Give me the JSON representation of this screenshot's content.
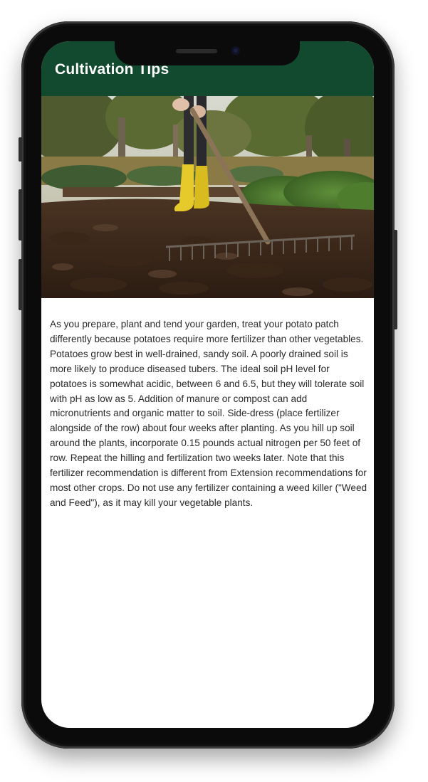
{
  "app": {
    "title": "Cultivation Tips"
  },
  "hero_image": {
    "subject": "person in yellow rubber boots raking dark tilled garden soil"
  },
  "content": {
    "paragraph": "As you prepare, plant and tend your garden, treat your potato patch differently because potatoes require more fertilizer than other vegetables. Potatoes grow best in well-drained, sandy soil. A poorly drained soil is more likely to produce diseased tubers. The ideal soil pH level for potatoes is somewhat acidic, between 6 and 6.5, but they will tolerate soil with pH as low as 5. Addition of manure or compost can add micronutrients and organic matter to soil. Side-dress (place fertilizer alongside of the row) about four weeks after planting. As you hill up soil around the plants, incorporate 0.15 pounds actual nitrogen per 50 feet of row. Repeat the hilling and fertilization two weeks later. Note that this fertilizer recommendation is different from Extension recommendations for most other crops. Do not use any fertilizer containing a weed killer (\"Weed and Feed\"), as it may kill your vegetable plants."
  },
  "colors": {
    "appbar": "#114a2e",
    "title_text": "#ffffff",
    "body_text": "#2a2a2a"
  }
}
